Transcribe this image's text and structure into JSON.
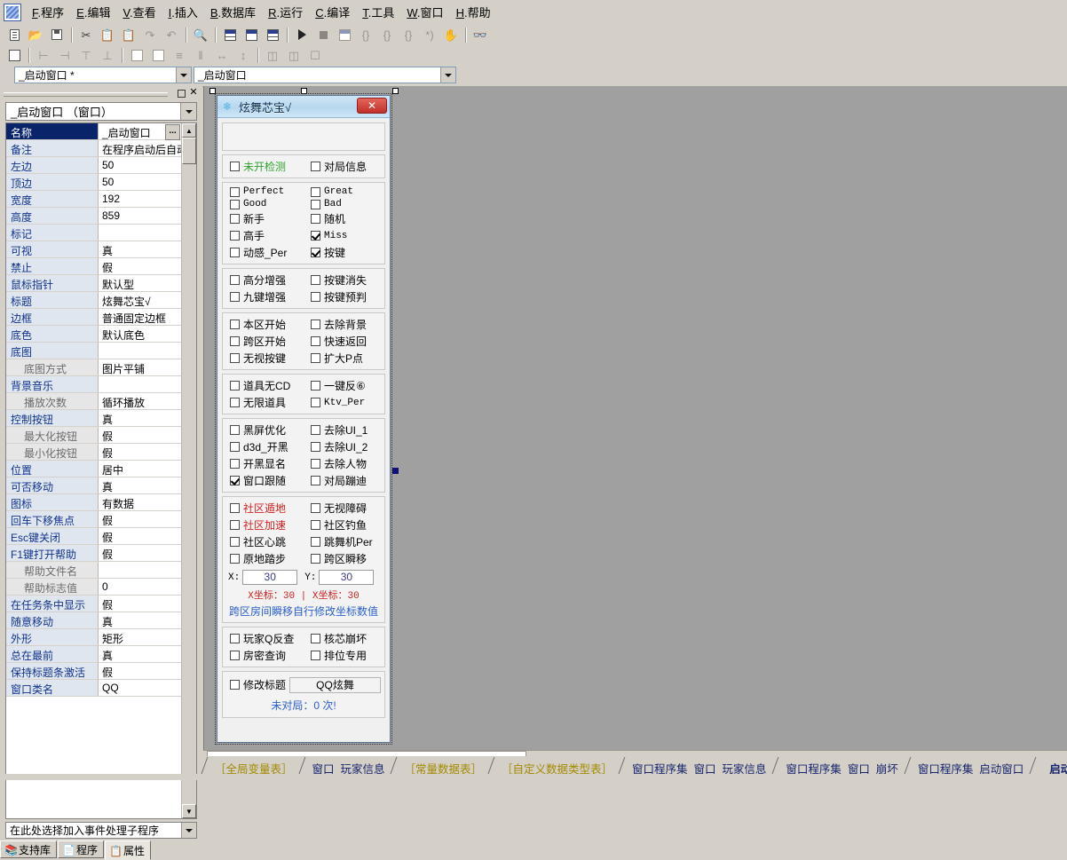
{
  "app": {
    "logo_icon": "e-language-logo-icon",
    "menu": [
      {
        "key": "F",
        "label": "程序"
      },
      {
        "key": "E",
        "label": "编辑"
      },
      {
        "key": "V",
        "label": "查看"
      },
      {
        "key": "I",
        "label": "插入"
      },
      {
        "key": "B",
        "label": "数据库"
      },
      {
        "key": "R",
        "label": "运行"
      },
      {
        "key": "C",
        "label": "编译"
      },
      {
        "key": "T",
        "label": "工具"
      },
      {
        "key": "W",
        "label": "窗口"
      },
      {
        "key": "H",
        "label": "帮助"
      }
    ]
  },
  "toolbar_top": {
    "icons": [
      "new-document-icon",
      "open-folder-icon",
      "save-icon",
      "sep",
      "cut-icon",
      "copy-icon",
      "paste-icon",
      "redo-icon",
      "undo-icon",
      "sep",
      "find-in-page-icon",
      "sep",
      "layout-columns-icon",
      "layout-rows-icon",
      "layout-mixed-icon",
      "sep",
      "run-icon",
      "stop-icon",
      "debug-window-icon",
      "step-into-icon",
      "step-over-icon",
      "step-out-icon",
      "run-to-cursor-icon",
      "pause-hand-icon",
      "sep",
      "find-binoculars-icon"
    ]
  },
  "toolbar_second": {
    "icons": [
      "form-designer-icon",
      "sep",
      "align-left-icon",
      "align-right-icon",
      "align-top-icon",
      "align-bottom-icon",
      "sep",
      "center-horizontal-icon",
      "center-vertical-icon",
      "same-width-icon",
      "same-height-icon",
      "spacing-horizontal-icon",
      "spacing-vertical-icon",
      "sep",
      "size-width-icon",
      "size-height-icon",
      "size-both-icon"
    ]
  },
  "combo_row": {
    "left_value": "_启动窗口 *",
    "right_value": "_启动窗口"
  },
  "left_panel": {
    "panel_min_tooltip": "最小化",
    "panel_close_tooltip": "关闭",
    "object_combo_value": "_启动窗口 （窗口）",
    "prop_rows": [
      {
        "name": "名称",
        "value": "_启动窗口",
        "selected": true,
        "sub": false,
        "button": "..."
      },
      {
        "name": "备注",
        "value": "在程序启动后自动",
        "selected": false,
        "sub": false
      },
      {
        "name": "左边",
        "value": "50",
        "selected": false,
        "sub": false
      },
      {
        "name": "顶边",
        "value": "50",
        "selected": false,
        "sub": false
      },
      {
        "name": "宽度",
        "value": "192",
        "selected": false,
        "sub": false
      },
      {
        "name": "高度",
        "value": "859",
        "selected": false,
        "sub": false
      },
      {
        "name": "标记",
        "value": "",
        "selected": false,
        "sub": false
      },
      {
        "name": "可视",
        "value": "真",
        "selected": false,
        "sub": false
      },
      {
        "name": "禁止",
        "value": "假",
        "selected": false,
        "sub": false
      },
      {
        "name": "鼠标指针",
        "value": "默认型",
        "selected": false,
        "sub": false
      },
      {
        "name": "标题",
        "value": "炫舞芯宝√",
        "selected": false,
        "sub": false
      },
      {
        "name": "边框",
        "value": "普通固定边框",
        "selected": false,
        "sub": false
      },
      {
        "name": "底色",
        "value": "默认底色",
        "selected": false,
        "sub": false
      },
      {
        "name": "底图",
        "value": "",
        "selected": false,
        "sub": false
      },
      {
        "name": "底图方式",
        "value": "图片平铺",
        "selected": false,
        "sub": true
      },
      {
        "name": "背景音乐",
        "value": "",
        "selected": false,
        "sub": false
      },
      {
        "name": "播放次数",
        "value": "循环播放",
        "selected": false,
        "sub": true
      },
      {
        "name": "控制按钮",
        "value": "真",
        "selected": false,
        "sub": false
      },
      {
        "name": "最大化按钮",
        "value": "假",
        "selected": false,
        "sub": true
      },
      {
        "name": "最小化按钮",
        "value": "假",
        "selected": false,
        "sub": true
      },
      {
        "name": "位置",
        "value": "居中",
        "selected": false,
        "sub": false
      },
      {
        "name": "可否移动",
        "value": "真",
        "selected": false,
        "sub": false
      },
      {
        "name": "图标",
        "value": "有数据",
        "selected": false,
        "sub": false
      },
      {
        "name": "回车下移焦点",
        "value": "假",
        "selected": false,
        "sub": false
      },
      {
        "name": "Esc键关闭",
        "value": "假",
        "selected": false,
        "sub": false
      },
      {
        "name": "F1键打开帮助",
        "value": "假",
        "selected": false,
        "sub": false
      },
      {
        "name": "帮助文件名",
        "value": "",
        "selected": false,
        "sub": true
      },
      {
        "name": "帮助标志值",
        "value": "0",
        "selected": false,
        "sub": true
      },
      {
        "name": "在任务条中显示",
        "value": "假",
        "selected": false,
        "sub": false
      },
      {
        "name": "随意移动",
        "value": "真",
        "selected": false,
        "sub": false
      },
      {
        "name": "外形",
        "value": "矩形",
        "selected": false,
        "sub": false
      },
      {
        "name": "总在最前",
        "value": "真",
        "selected": false,
        "sub": false
      },
      {
        "name": "保持标题条激活",
        "value": "假",
        "selected": false,
        "sub": false
      },
      {
        "name": "窗口类名",
        "value": "QQ",
        "selected": false,
        "sub": false
      }
    ],
    "event_combo_value": "在此处选择加入事件处理子程序",
    "bottom_tabs": [
      {
        "label": "支持库",
        "icon": "library-icon",
        "active": false
      },
      {
        "label": "程序",
        "icon": "program-icon",
        "active": false
      },
      {
        "label": "属性",
        "icon": "properties-icon",
        "active": true
      }
    ]
  },
  "form": {
    "title": "炫舞芯宝√",
    "title_icon": "app-snowflake-icon",
    "close_label": "✕",
    "groups": [
      {
        "id": "top-edit",
        "type": "edit",
        "value": ""
      },
      {
        "id": "group-detect",
        "type": "checkboxes",
        "items": [
          {
            "label": "未开检测",
            "checked": false,
            "color": "green"
          },
          {
            "label": "对局信息",
            "checked": false,
            "color": "normal"
          }
        ]
      },
      {
        "id": "group-judge",
        "type": "checkboxes",
        "items": [
          {
            "label": "Perfect",
            "checked": false,
            "color": "mono"
          },
          {
            "label": "Great",
            "checked": false,
            "color": "mono"
          },
          {
            "label": "Good",
            "checked": false,
            "color": "mono"
          },
          {
            "label": "Bad",
            "checked": false,
            "color": "mono"
          },
          {
            "label": "新手",
            "checked": false,
            "color": "normal"
          },
          {
            "label": "随机",
            "checked": false,
            "color": "normal"
          },
          {
            "label": "高手",
            "checked": false,
            "color": "normal"
          },
          {
            "label": "Miss",
            "checked": true,
            "color": "mono"
          },
          {
            "label": "动感_Per",
            "checked": false,
            "color": "normal"
          },
          {
            "label": "按键",
            "checked": true,
            "color": "normal"
          }
        ]
      },
      {
        "id": "group-enhance",
        "type": "checkboxes",
        "items": [
          {
            "label": "高分增强",
            "checked": false,
            "color": "normal"
          },
          {
            "label": "按键消失",
            "checked": false,
            "color": "normal"
          },
          {
            "label": "九键增强",
            "checked": false,
            "color": "normal"
          },
          {
            "label": "按键预判",
            "checked": false,
            "color": "normal"
          }
        ]
      },
      {
        "id": "group-start",
        "type": "checkboxes",
        "items": [
          {
            "label": "本区开始",
            "checked": false,
            "color": "normal"
          },
          {
            "label": "去除背景",
            "checked": false,
            "color": "normal"
          },
          {
            "label": "跨区开始",
            "checked": false,
            "color": "normal"
          },
          {
            "label": "快速返回",
            "checked": false,
            "color": "normal"
          },
          {
            "label": "无视按键",
            "checked": false,
            "color": "normal"
          },
          {
            "label": "扩大P点",
            "checked": false,
            "color": "normal"
          }
        ]
      },
      {
        "id": "group-items",
        "type": "checkboxes",
        "items": [
          {
            "label": "道具无CD",
            "checked": false,
            "color": "normal"
          },
          {
            "label": "一键反⑥",
            "checked": false,
            "color": "normal"
          },
          {
            "label": "无限道具",
            "checked": false,
            "color": "normal"
          },
          {
            "label": "Ktv_Per",
            "checked": false,
            "color": "mono"
          }
        ]
      },
      {
        "id": "group-screen",
        "type": "checkboxes",
        "items": [
          {
            "label": "黑屏优化",
            "checked": false,
            "color": "normal"
          },
          {
            "label": "去除UI_1",
            "checked": false,
            "color": "normal"
          },
          {
            "label": "d3d_开黑",
            "checked": false,
            "color": "normal"
          },
          {
            "label": "去除UI_2",
            "checked": false,
            "color": "normal"
          },
          {
            "label": "开黑显名",
            "checked": false,
            "color": "normal"
          },
          {
            "label": "去除人物",
            "checked": false,
            "color": "normal"
          },
          {
            "label": "窗口跟随",
            "checked": true,
            "color": "normal"
          },
          {
            "label": "对局蹦迪",
            "checked": false,
            "color": "normal"
          }
        ]
      },
      {
        "id": "group-community",
        "type": "checkboxes",
        "items": [
          {
            "label": "社区遁地",
            "checked": false,
            "color": "red"
          },
          {
            "label": "无视障碍",
            "checked": false,
            "color": "normal"
          },
          {
            "label": "社区加速",
            "checked": false,
            "color": "red"
          },
          {
            "label": "社区钓鱼",
            "checked": false,
            "color": "normal"
          },
          {
            "label": "社区心跳",
            "checked": false,
            "color": "normal"
          },
          {
            "label": "跳舞机Per",
            "checked": false,
            "color": "normal"
          },
          {
            "label": "原地踏步",
            "checked": false,
            "color": "normal"
          },
          {
            "label": "跨区瞬移",
            "checked": false,
            "color": "normal"
          }
        ]
      },
      {
        "id": "group-coords",
        "type": "coords",
        "x_label": "X:",
        "x_value": "30",
        "y_label": "Y:",
        "y_value": "30",
        "red_note": "X坐标：30  |  X坐标：30",
        "blue_note": "跨区房间瞬移自行修改坐标数值"
      },
      {
        "id": "group-query",
        "type": "checkboxes",
        "items": [
          {
            "label": "玩家Q反查",
            "checked": false,
            "color": "normal"
          },
          {
            "label": "核芯崩坏",
            "checked": false,
            "color": "normal"
          },
          {
            "label": "房密查询",
            "checked": false,
            "color": "normal"
          },
          {
            "label": "排位专用",
            "checked": false,
            "color": "normal"
          }
        ]
      },
      {
        "id": "group-title",
        "type": "title",
        "checkbox_label": "修改标题",
        "checkbox_checked": false,
        "input_value": "QQ炫舞",
        "status_text": "未对局：0 次!"
      }
    ]
  },
  "tabstrip": {
    "tabs": [
      {
        "label": "［全局变量表］",
        "style": "yellow",
        "active": false
      },
      {
        "label": "窗口_玩家信息",
        "style": "blue",
        "active": false
      },
      {
        "label": "［常量数据表］",
        "style": "yellow",
        "active": false
      },
      {
        "label": "［自定义数据类型表］",
        "style": "yellow",
        "active": false
      },
      {
        "label": "窗口程序集_窗口_玩家信息",
        "style": "blue",
        "active": false
      },
      {
        "label": "窗口程序集_窗口_崩坏",
        "style": "blue",
        "active": false
      },
      {
        "label": "窗口程序集_启动窗口",
        "style": "blue",
        "active": false
      },
      {
        "label": "_启动窗口",
        "style": "blue",
        "active": true
      }
    ]
  },
  "colors": {
    "canvas_bg": "#a0a0a0",
    "chrome": "#d4d0c8",
    "selected_prop": "#0a246a",
    "accent_red": "#d42020",
    "accent_green": "#2fa32f",
    "accent_blue": "#2a5fd0"
  }
}
